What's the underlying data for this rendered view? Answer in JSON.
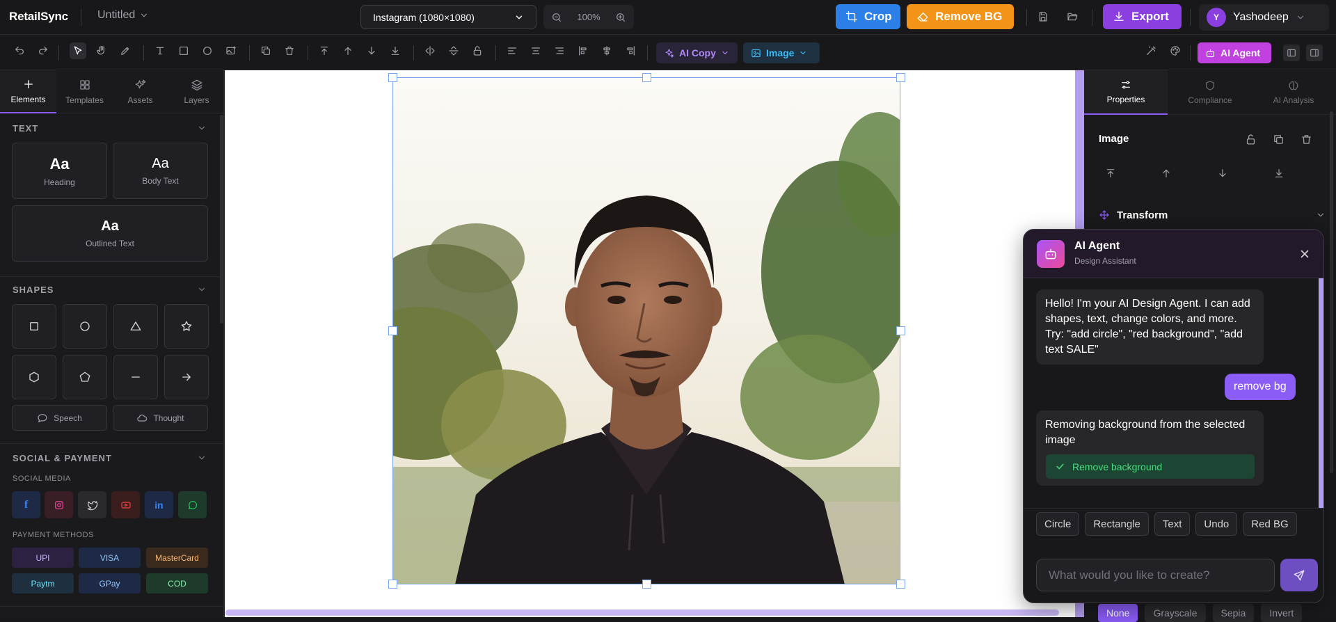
{
  "app": {
    "logo": "RetailSync",
    "doc_title": "Untitled"
  },
  "topbar": {
    "size_preset": "Instagram (1080×1080)",
    "zoom": "100%",
    "crop_label": "Crop",
    "removebg_label": "Remove BG",
    "export_label": "Export",
    "user_initial": "Y",
    "user_name": "Yashodeep"
  },
  "toolbar": {
    "aicopy_label": "AI Copy",
    "image_label": "Image",
    "aiagent_label": "AI Agent"
  },
  "left_tabs": [
    "Elements",
    "Templates",
    "Assets",
    "Layers"
  ],
  "text_section": {
    "title": "TEXT",
    "items": [
      {
        "glyph": "Aa",
        "label": "Heading"
      },
      {
        "glyph": "Aa",
        "label": "Body Text"
      },
      {
        "glyph": "Aa",
        "label": "Outlined Text"
      }
    ]
  },
  "shapes_section": {
    "title": "SHAPES",
    "shape_icons": [
      "square-icon",
      "circle-icon",
      "triangle-icon",
      "star-icon",
      "hexagon-icon",
      "pentagon-icon",
      "line-icon",
      "arrow-icon"
    ],
    "bubbles": [
      {
        "label": "Speech"
      },
      {
        "label": "Thought"
      }
    ]
  },
  "social_section": {
    "title": "SOCIAL & PAYMENT",
    "social_label": "SOCIAL MEDIA",
    "social_icons": [
      "facebook-icon",
      "instagram-icon",
      "twitter-icon",
      "youtube-icon",
      "linkedin-icon",
      "whatsapp-icon"
    ],
    "payment_label": "PAYMENT METHODS",
    "payments": [
      "UPI",
      "VISA",
      "MasterCard",
      "Paytm",
      "GPay",
      "COD"
    ]
  },
  "right_tabs": [
    "Properties",
    "Compliance",
    "AI Analysis"
  ],
  "properties": {
    "heading": "Image",
    "transform_label": "Transform",
    "filters": [
      "None",
      "Grayscale",
      "Sepia",
      "Invert"
    ],
    "active_filter": "None"
  },
  "chat": {
    "title": "AI Agent",
    "subtitle": "Design Assistant",
    "messages": [
      {
        "role": "bot",
        "text": "Hello! I'm your AI Design Agent. I can add shapes, text, change colors, and more. Try: \"add circle\", \"red background\", \"add text SALE\""
      },
      {
        "role": "user",
        "text": "remove bg"
      },
      {
        "role": "bot",
        "text": "Removing background from the selected image"
      }
    ],
    "action_label": "Remove background",
    "quick_actions": [
      "Circle",
      "Rectangle",
      "Text",
      "Undo",
      "Red BG"
    ],
    "input_placeholder": "What would you like to create?"
  },
  "colors": {
    "crop": "#2b7fe7",
    "removebg": "#f39418",
    "export": "#8b3fe0",
    "accent": "#8b5cf6",
    "agent": "#c040e0"
  }
}
